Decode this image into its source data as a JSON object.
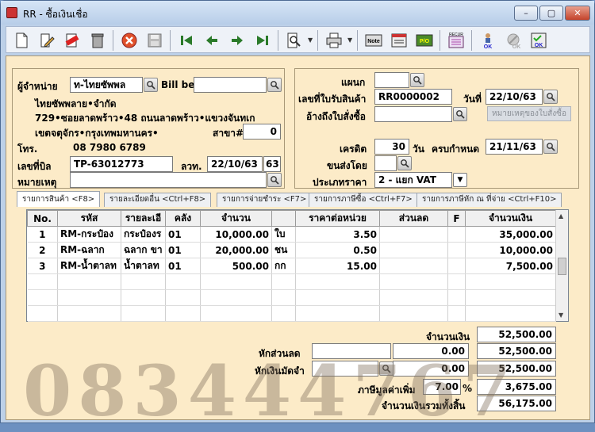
{
  "window": {
    "title": "RR - ซื้อเงินเชื่อ",
    "controls": {
      "minimize": "–",
      "maximize": "▢",
      "close": "✕"
    }
  },
  "toolbar": {
    "buttons": [
      "new-doc-icon",
      "edit-icon",
      "void-icon",
      "trash-icon",
      "cancel-icon",
      "save-icon",
      "first-record-icon",
      "prev-record-icon",
      "next-record-icon",
      "last-record-icon",
      "search-doc-icon",
      "print-icon",
      "note-icon",
      "form-icon",
      "po-icon",
      "recur-icon",
      "approve-ok-icon",
      "approve-disabled-icon",
      "check-ok-icon"
    ],
    "labels": {
      "note": "Note",
      "po": "P/O",
      "recur": "RECUR",
      "ok": "OK"
    }
  },
  "vendor": {
    "label_supplier": "ผู้จำหน่าย",
    "supplier_code": "ท-ไทยซัพพล",
    "label_bill": "Bill be",
    "bill_value": "",
    "supplier_name": "ไทยซัพพลาย•จำกัด",
    "address1": "729•ซอยลาดพร้าว•48 ถนนลาดพร้าว•แขวงจันทเก",
    "address2": "เขตจตุจักร•กรุงเทพมหานคร•",
    "label_branch": "สาขา#",
    "branch": "0",
    "label_phone": "โทร.",
    "phone": "08 7980 6789",
    "label_billno": "เลขที่บิล",
    "billno": "TP-63012773",
    "label_billdate": "ลวท.",
    "billdate": "22/10/63",
    "billdate_extra": "63",
    "label_remark": "หมายเหตุ",
    "remark": ""
  },
  "doc": {
    "label_dept": "แผนก",
    "dept": "",
    "label_receipt": "เลขที่ใบรับสินค้า",
    "receipt_no": "RR0000002",
    "label_date": "วันที่",
    "date": "22/10/63",
    "label_ref": "อ้างถึงใบสั่งซื้อ",
    "ref": "",
    "po_note_btn": "หมายเหตุของใบสั่งซื้อ",
    "label_credit": "เครดิต",
    "credit": "30",
    "label_days": "วัน",
    "label_due": "ครบกำหนด",
    "due": "21/11/63",
    "label_ship": "ขนส่งโดย",
    "ship": "",
    "label_pricetype": "ประเภทราคา",
    "pricetype": "2 - แยก VAT"
  },
  "tabs": [
    "รายการสินค้า <F8>",
    "รายละเอียดอื่น <Ctrl+F8>",
    "รายการจ่ายชำระ <F7>",
    "รายการภาษีซื้อ <Ctrl+F7>",
    "รายการภาษีหัก ณ ที่จ่าย <Ctrl+F10>"
  ],
  "grid": {
    "headers": [
      "No.",
      "รหัส",
      "รายละเอี",
      "คลัง",
      "จำนวน",
      "",
      "ราคาต่อหน่วย",
      "ส่วนลด",
      "F",
      "จำนวนเงิน"
    ],
    "rows": [
      [
        "1",
        "RM-กระป๋อง",
        "กระป๋องร",
        "01",
        "10,000.00",
        "ใบ",
        "3.50",
        "",
        "",
        "35,000.00"
      ],
      [
        "2",
        "RM-ฉลาก",
        "ฉลาก ขา",
        "01",
        "20,000.00",
        "ชน",
        "0.50",
        "",
        "",
        "10,000.00"
      ],
      [
        "3",
        "RM-น้ำตาลท",
        "น้ำตาลท",
        "01",
        "500.00",
        "กก",
        "15.00",
        "",
        "",
        "7,500.00"
      ]
    ]
  },
  "totals": {
    "label_amount": "จำนวนเงิน",
    "amount": "52,500.00",
    "label_discount": "หักส่วนลด",
    "discount_text": "",
    "discount": "0.00",
    "after_discount": "52,500.00",
    "label_deposit": "หักเงินมัดจำ",
    "deposit_text": "",
    "deposit": "0.00",
    "after_deposit": "52,500.00",
    "label_vat": "ภาษีมูลค่าเพิ่ม",
    "vat_rate": "7.00",
    "vat_pct": "%",
    "vat": "3,675.00",
    "label_grand": "จำนวนเงินรวมทั้งสิ้น",
    "grand": "56,175.00"
  },
  "watermark": "083444767"
}
